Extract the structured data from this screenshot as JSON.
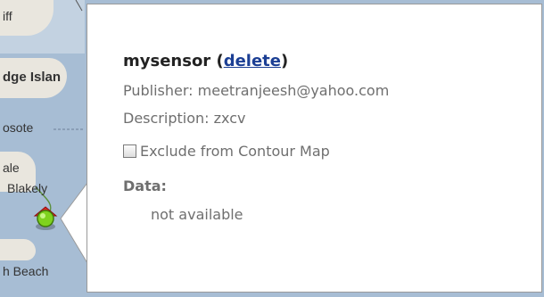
{
  "map": {
    "labels": [
      "iff",
      "dge Islan",
      "osote",
      "ale",
      "Blakely",
      "h Beach"
    ]
  },
  "popup": {
    "sensor_name": "mysensor",
    "open_paren": " (",
    "delete_link": "delete",
    "close_paren": ")",
    "publisher": "Publisher: meetranjeesh@yahoo.com",
    "description": "Description: zxcv",
    "exclude_label": "Exclude from Contour Map",
    "exclude_checked": false,
    "data_label": "Data:",
    "data_value": "not available"
  },
  "colors": {
    "water": "#a7bdd4",
    "land": "#e9e6de",
    "link": "#1c3f94",
    "muted_text": "#6f6f6f",
    "marker_green": "#7fd21e",
    "marker_red": "#e0201e"
  }
}
